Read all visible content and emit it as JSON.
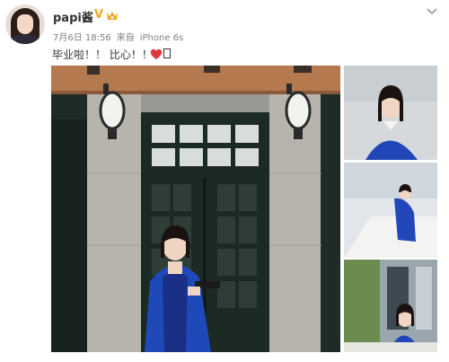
{
  "post": {
    "username": "papi酱",
    "date": "7月6日 18:56",
    "source_prefix": "来自",
    "device": "iPhone 6s",
    "text": "毕业啦！！ 比心！！",
    "icons": [
      "crown-icon",
      "verified-v-icon",
      "heart-icon",
      "chevron-down-icon"
    ],
    "accent": "#f4a623",
    "heart_color": "#e0383b"
  },
  "images": [
    {
      "role": "main-photo"
    },
    {
      "role": "thumbnail-1"
    },
    {
      "role": "thumbnail-2"
    },
    {
      "role": "thumbnail-3"
    }
  ]
}
